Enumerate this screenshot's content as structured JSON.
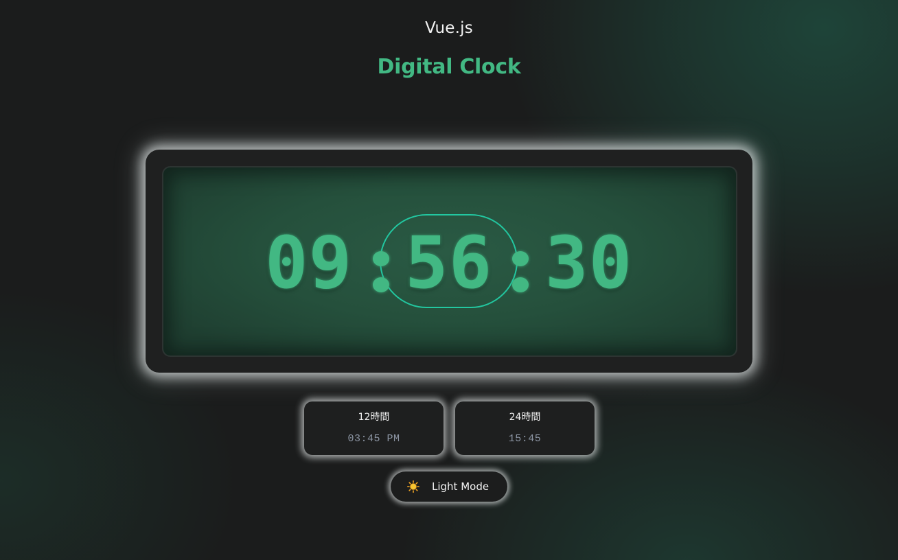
{
  "app": {
    "title": "Vue.js",
    "heading": "Digital Clock"
  },
  "clock": {
    "hours": "09",
    "minutes": "56",
    "seconds": "30",
    "highlighted_segment": "minutes",
    "digit_color": "#42b883",
    "highlight_color": "#22c7a0"
  },
  "formats": [
    {
      "label": "12時間",
      "value": "03:45 PM"
    },
    {
      "label": "24時間",
      "value": "15:45"
    }
  ],
  "mode_toggle": {
    "icon": "sun-icon",
    "label": "Light Mode"
  },
  "colors": {
    "accent": "#42b883",
    "background": "#1b1c1c"
  }
}
